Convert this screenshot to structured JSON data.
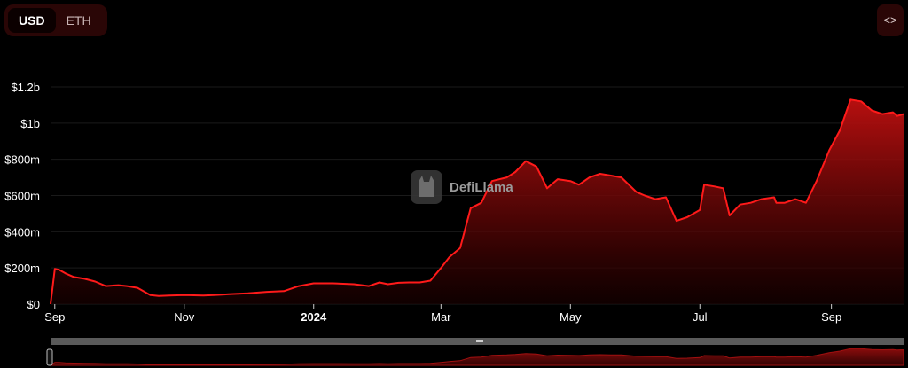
{
  "toggle": {
    "options": [
      "USD",
      "ETH"
    ],
    "active": "USD"
  },
  "embed_button": {
    "label": "<>"
  },
  "watermark": {
    "text": "DefiLlama"
  },
  "colors": {
    "line": "#ff1a1a",
    "fill_top": "#b30f0f",
    "grid": "#1a1a1a",
    "background": "#000000",
    "slider_bar": "#5a5a5a"
  },
  "chart_data": {
    "type": "area",
    "title": "",
    "xlabel": "",
    "ylabel": "",
    "ylim": [
      0,
      1200000000
    ],
    "grid": true,
    "y_ticks": [
      {
        "value": 0,
        "label": "$0"
      },
      {
        "value": 200000000,
        "label": "$200m"
      },
      {
        "value": 400000000,
        "label": "$400m"
      },
      {
        "value": 600000000,
        "label": "$600m"
      },
      {
        "value": 800000000,
        "label": "$800m"
      },
      {
        "value": 1000000000,
        "label": "$1b"
      },
      {
        "value": 1200000000,
        "label": "$1.2b"
      }
    ],
    "x_ticks": [
      {
        "date": "2023-09-01",
        "label": "Sep",
        "bold": false
      },
      {
        "date": "2023-11-01",
        "label": "Nov",
        "bold": false
      },
      {
        "date": "2024-01-01",
        "label": "2024",
        "bold": true
      },
      {
        "date": "2024-03-01",
        "label": "Mar",
        "bold": false
      },
      {
        "date": "2024-05-01",
        "label": "May",
        "bold": false
      },
      {
        "date": "2024-07-01",
        "label": "Jul",
        "bold": false
      },
      {
        "date": "2024-09-01",
        "label": "Sep",
        "bold": false
      }
    ],
    "series": [
      {
        "x": [
          "2023-08-30",
          "2023-09-01",
          "2023-09-03",
          "2023-09-06",
          "2023-09-10",
          "2023-09-15",
          "2023-09-20",
          "2023-09-25",
          "2023-10-01",
          "2023-10-05",
          "2023-10-10",
          "2023-10-16",
          "2023-10-20",
          "2023-10-25",
          "2023-11-01",
          "2023-11-10",
          "2023-11-15",
          "2023-11-22",
          "2023-12-01",
          "2023-12-10",
          "2023-12-18",
          "2023-12-25",
          "2024-01-01",
          "2024-01-10",
          "2024-01-20",
          "2024-01-27",
          "2024-02-01",
          "2024-02-05",
          "2024-02-10",
          "2024-02-15",
          "2024-02-20",
          "2024-02-25",
          "2024-03-01",
          "2024-03-05",
          "2024-03-10",
          "2024-03-15",
          "2024-03-20",
          "2024-03-25",
          "2024-04-01",
          "2024-04-05",
          "2024-04-10",
          "2024-04-15",
          "2024-04-20",
          "2024-04-25",
          "2024-05-01",
          "2024-05-05",
          "2024-05-10",
          "2024-05-15",
          "2024-05-20",
          "2024-05-25",
          "2024-06-01",
          "2024-06-05",
          "2024-06-10",
          "2024-06-15",
          "2024-06-20",
          "2024-06-25",
          "2024-07-01",
          "2024-07-03",
          "2024-07-08",
          "2024-07-12",
          "2024-07-15",
          "2024-07-20",
          "2024-07-25",
          "2024-07-30",
          "2024-08-05",
          "2024-08-06",
          "2024-08-10",
          "2024-08-15",
          "2024-08-20",
          "2024-08-25",
          "2024-08-31",
          "2024-09-05",
          "2024-09-10",
          "2024-09-15",
          "2024-09-20",
          "2024-09-25",
          "2024-09-30",
          "2024-10-02",
          "2024-10-05"
        ],
        "values": [
          0,
          195000000,
          190000000,
          170000000,
          150000000,
          140000000,
          125000000,
          100000000,
          105000000,
          100000000,
          90000000,
          50000000,
          45000000,
          48000000,
          50000000,
          48000000,
          50000000,
          55000000,
          60000000,
          68000000,
          72000000,
          100000000,
          115000000,
          115000000,
          110000000,
          100000000,
          120000000,
          110000000,
          118000000,
          120000000,
          120000000,
          130000000,
          200000000,
          260000000,
          310000000,
          530000000,
          560000000,
          680000000,
          700000000,
          730000000,
          790000000,
          760000000,
          640000000,
          690000000,
          680000000,
          660000000,
          700000000,
          720000000,
          710000000,
          700000000,
          620000000,
          600000000,
          580000000,
          590000000,
          460000000,
          480000000,
          520000000,
          660000000,
          650000000,
          640000000,
          490000000,
          550000000,
          560000000,
          580000000,
          590000000,
          560000000,
          560000000,
          580000000,
          560000000,
          680000000,
          850000000,
          960000000,
          1130000000,
          1120000000,
          1070000000,
          1050000000,
          1060000000,
          1040000000,
          1050000000
        ]
      }
    ]
  }
}
